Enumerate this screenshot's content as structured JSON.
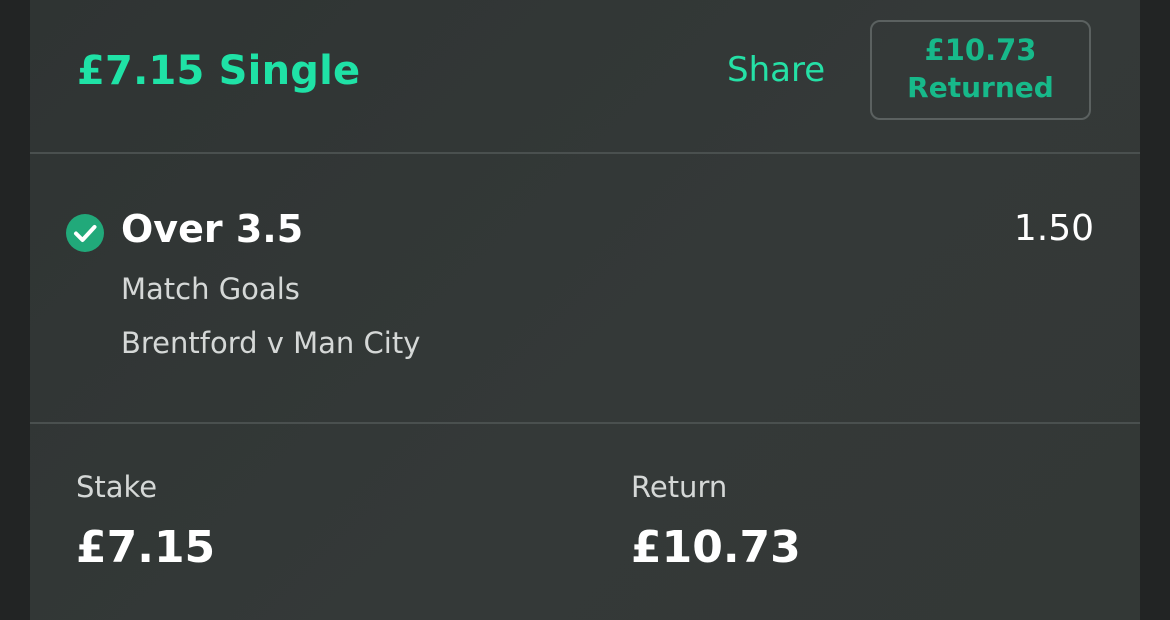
{
  "bet": {
    "title": "£7.15 Single",
    "share_label": "Share",
    "returned_amount": "£10.73",
    "returned_label": "Returned"
  },
  "selection": {
    "status_icon": "check-circle-icon",
    "name": "Over 3.5",
    "odds": "1.50",
    "market": "Match Goals",
    "event": "Brentford v Man City"
  },
  "totals": {
    "stake_label": "Stake",
    "stake_value": "£7.15",
    "return_label": "Return",
    "return_value": "£10.73"
  },
  "colors": {
    "accent": "#1fe2a6",
    "returned_text": "#17b98a",
    "card_background": "#323736",
    "page_background": "#222424",
    "check_circle": "#21a97a"
  }
}
